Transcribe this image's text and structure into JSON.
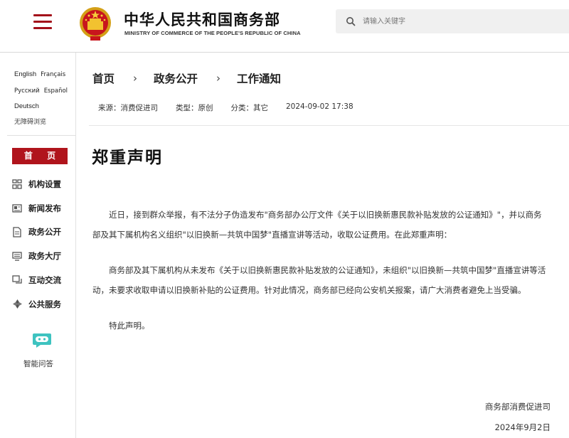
{
  "header": {
    "site_title": "中华人民共和国商务部",
    "site_subtitle": "MINISTRY OF COMMERCE OF THE PEOPLE'S REPUBLIC OF CHINA",
    "search_placeholder": "请输入关键字"
  },
  "sidebar": {
    "languages": [
      [
        "English",
        "Français"
      ],
      [
        "Русский",
        "Español"
      ],
      [
        "Deutsch"
      ],
      [
        "无障碍浏览"
      ]
    ],
    "home_label": "首 页",
    "nav_items": [
      {
        "label": "机构设置",
        "icon": "org-chart-icon"
      },
      {
        "label": "新闻发布",
        "icon": "news-icon"
      },
      {
        "label": "政务公开",
        "icon": "document-icon"
      },
      {
        "label": "政务大厅",
        "icon": "monitor-icon"
      },
      {
        "label": "互动交流",
        "icon": "chat-icon"
      },
      {
        "label": "公共服务",
        "icon": "service-icon"
      }
    ],
    "ai_label": "智能问答"
  },
  "breadcrumb": [
    "首页",
    "政务公开",
    "工作通知"
  ],
  "meta": {
    "source": "来源：消费促进司",
    "type": "类型：原创",
    "category": "分类：其它",
    "datetime": "2024-09-02 17:38"
  },
  "article": {
    "title": "郑重声明",
    "paragraphs": [
      "近日，接到群众举报，有不法分子伪造发布\"商务部办公厅文件《关于以旧换新惠民款补贴发放的公证通知》\"，并以商务部及其下属机构名义组织\"以旧换新—共筑中国梦\"直播宣讲等活动，收取公证费用。在此郑重声明：",
      "商务部及其下属机构从未发布《关于以旧换新惠民款补贴发放的公证通知》，未组织\"以旧换新—共筑中国梦\"直播宣讲等活动，未要求收取申请以旧换新补贴的公证费用。针对此情况，商务部已经向公安机关报案，请广大消费者避免上当受骗。",
      "特此声明。"
    ],
    "signature": "商务部消费促进司",
    "date": "2024年9月2日"
  },
  "colors": {
    "brand_red": "#b0141c",
    "menu_red": "#a3101a"
  }
}
